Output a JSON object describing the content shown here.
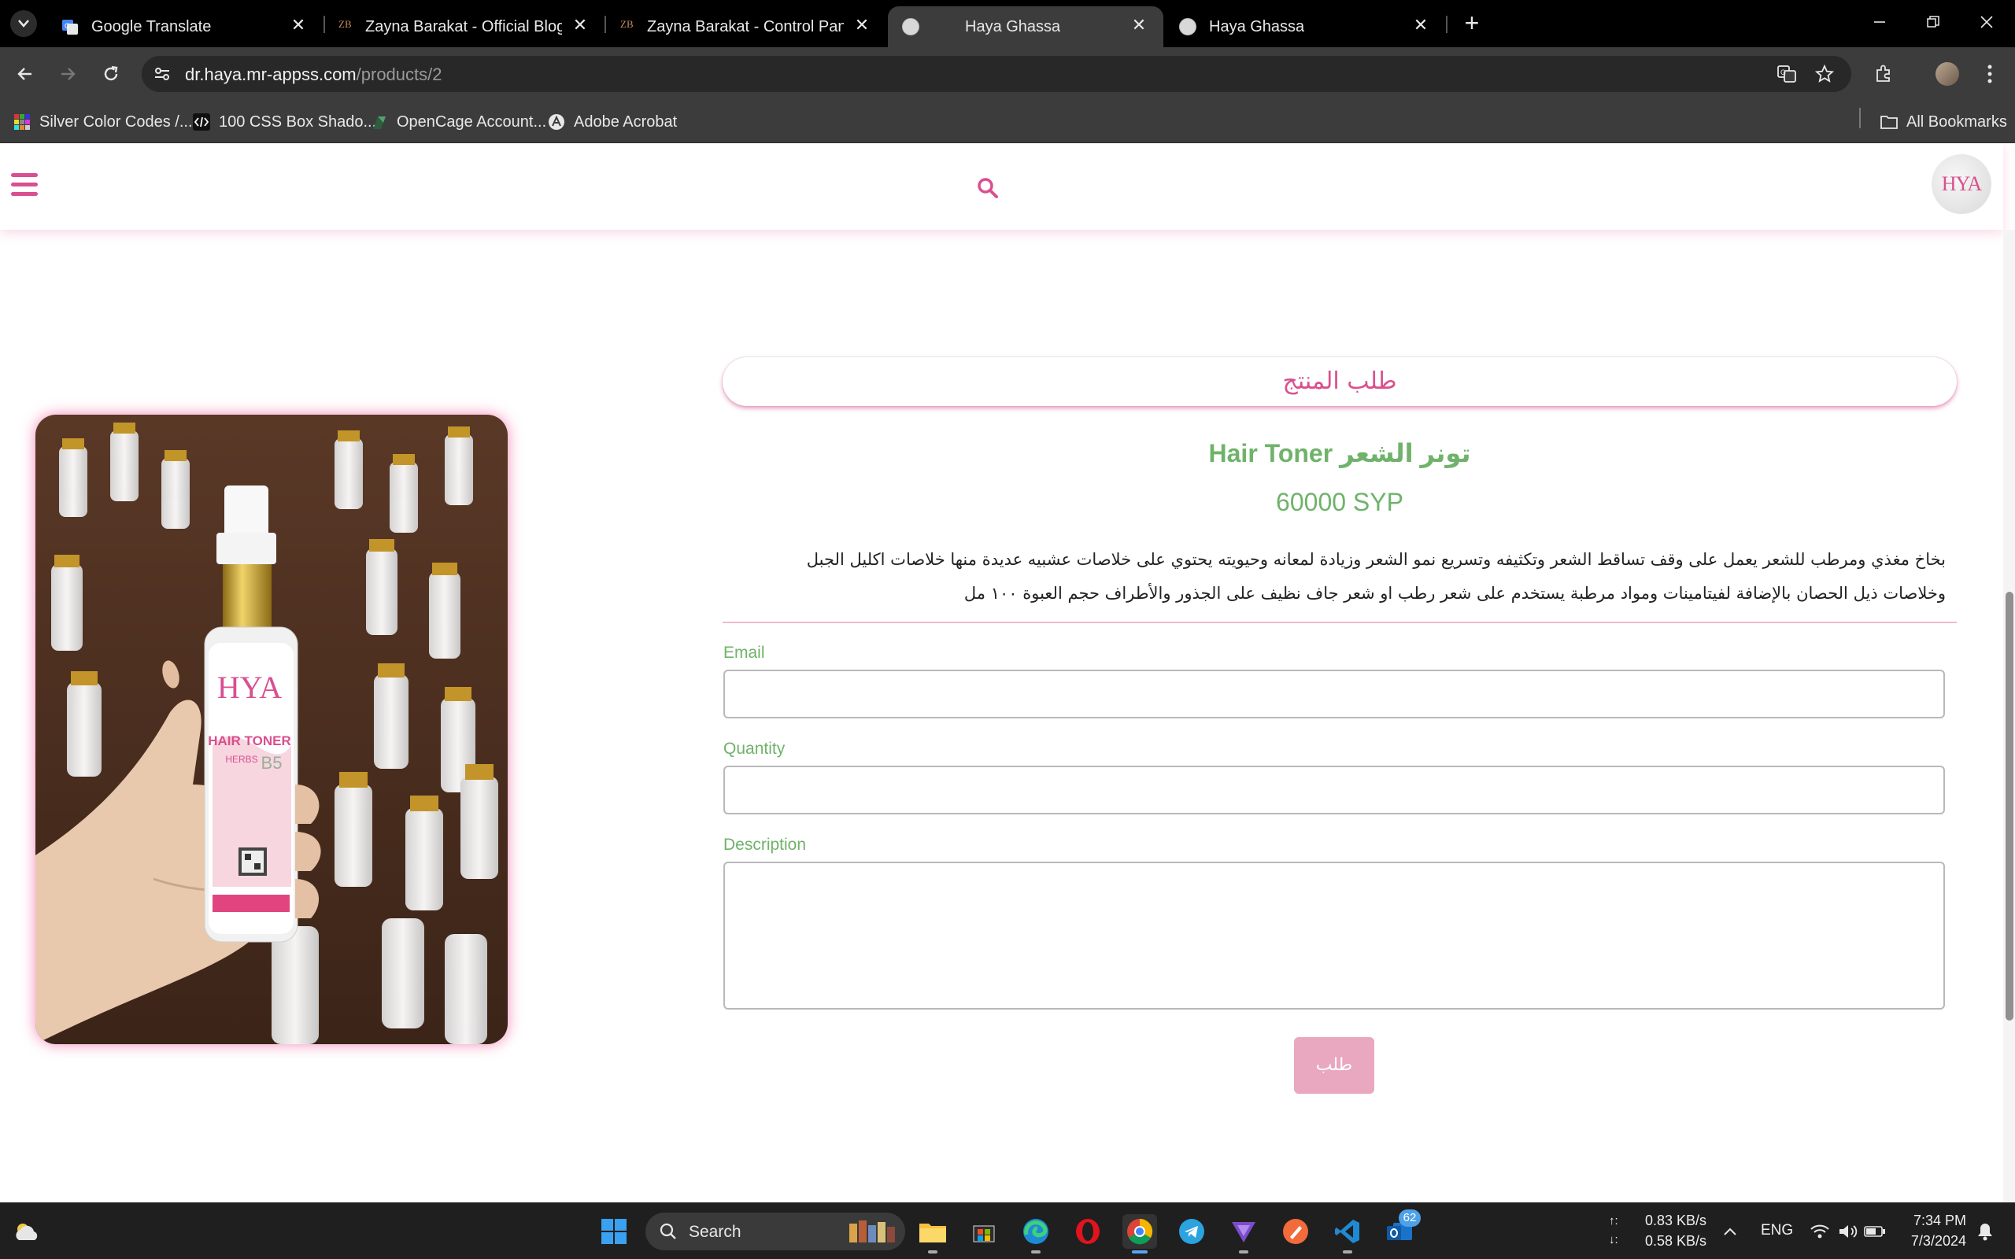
{
  "browser": {
    "tabs": [
      {
        "title": "Google Translate",
        "favicon": "google-translate-icon",
        "active": false
      },
      {
        "title": "Zayna Barakat - Official Blogger",
        "favicon": "zb-logo-icon",
        "active": false
      },
      {
        "title": "Zayna Barakat - Control Panel",
        "favicon": "zb-logo-icon",
        "active": false
      },
      {
        "title": "Haya Ghassa",
        "favicon": "haya-logo-icon",
        "active": true
      },
      {
        "title": "Haya Ghassa",
        "favicon": "haya-logo-icon",
        "active": false
      }
    ],
    "url_host": "dr.haya.mr-appss.com",
    "url_path": "/products/2",
    "bookmarks": [
      {
        "label": "Silver Color Codes /...",
        "icon": "color-grid-icon"
      },
      {
        "label": "100 CSS Box Shado...",
        "icon": "code-icon"
      },
      {
        "label": "OpenCage Account...",
        "icon": "opencage-icon"
      },
      {
        "label": "Adobe Acrobat",
        "icon": "acrobat-icon"
      }
    ],
    "all_bookmarks_label": "All Bookmarks"
  },
  "site": {
    "logo_text": "HYA",
    "accent_color": "#d94f8f",
    "green_color": "#6fb36a"
  },
  "product": {
    "order_title": "طلب المنتج",
    "name": "Hair Toner تونر الشعر",
    "price": "60000 SYP",
    "description": "بخاخ مغذي ومرطب للشعر يعمل على وقف تساقط الشعر وتكثيفه وتسريع نمو الشعر وزيادة لمعانه وحيويته يحتوي على خلاصات عشبيه عديدة منها خلاصات اكليل الجبل وخلاصات ذيل الحصان بالإضافة لفيتامينات ومواد مرطبة يستخدم على شعر رطب او شعر جاف نظيف على الجذور والأطراف حجم العبوة ١٠٠ مل",
    "image_label": "HAIR TONER",
    "image_sublabel": "HERBS"
  },
  "form": {
    "email_label": "Email",
    "email_value": "",
    "quantity_label": "Quantity",
    "quantity_value": "",
    "description_label": "Description",
    "description_value": "",
    "submit_label": "طلب"
  },
  "taskbar": {
    "search_placeholder": "Search",
    "notification_badge": "62",
    "upload_speed": "0.83 KB/s",
    "download_speed": "0.58 KB/s",
    "language": "ENG",
    "time": "7:34 PM",
    "date": "7/3/2024"
  }
}
